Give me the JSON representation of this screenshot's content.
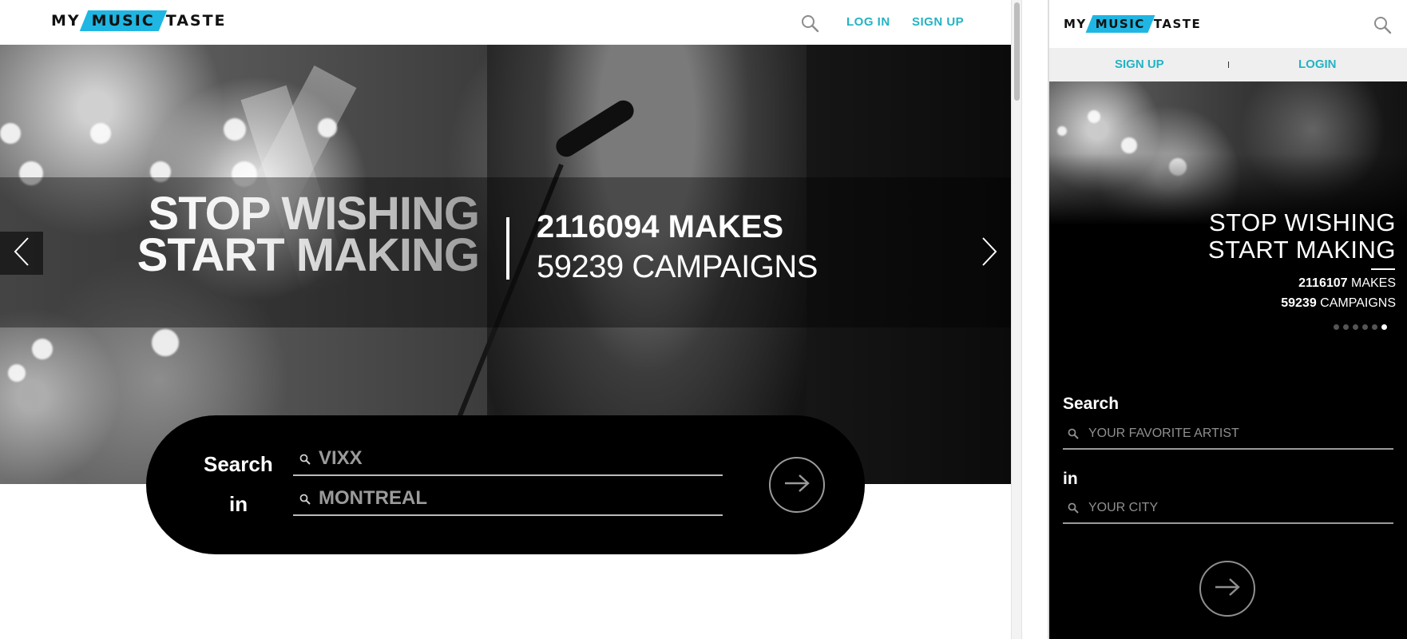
{
  "brand": {
    "logo_left": "MY",
    "logo_mid": "MUSIC",
    "logo_right": "TASTE",
    "accent": "#1fb6e3",
    "link_color": "#23b3c4"
  },
  "desktop": {
    "header": {
      "search_icon": "search-icon",
      "login_label": "LOG IN",
      "signup_label": "SIGN UP"
    },
    "hero": {
      "slogan_line1": "STOP WISHING",
      "slogan_line2": "START MAKING",
      "makes_text": "2116094 MAKES",
      "campaigns_text": "59239 CAMPAIGNS",
      "prev_icon": "chevron-left-icon",
      "next_icon": "chevron-right-icon"
    },
    "search": {
      "search_label": "Search",
      "in_label": "in",
      "artist_value": "VIXX",
      "city_value": "MONTREAL",
      "go_icon": "arrow-right-icon"
    }
  },
  "mobile": {
    "header": {
      "search_icon": "search-icon"
    },
    "auth": {
      "signup_label": "SIGN UP",
      "login_label": "LOGIN"
    },
    "hero": {
      "slogan_line1": "STOP WISHING",
      "slogan_line2": "START MAKING",
      "makes_count": "2116107",
      "makes_label": "MAKES",
      "campaigns_count": "59239",
      "campaigns_label": "CAMPAIGNS",
      "dots_total": 6,
      "active_dot": 6
    },
    "search": {
      "search_label": "Search",
      "artist_placeholder": "YOUR FAVORITE ARTIST",
      "in_label": "in",
      "city_placeholder": "YOUR CITY",
      "go_icon": "arrow-right-icon"
    }
  }
}
